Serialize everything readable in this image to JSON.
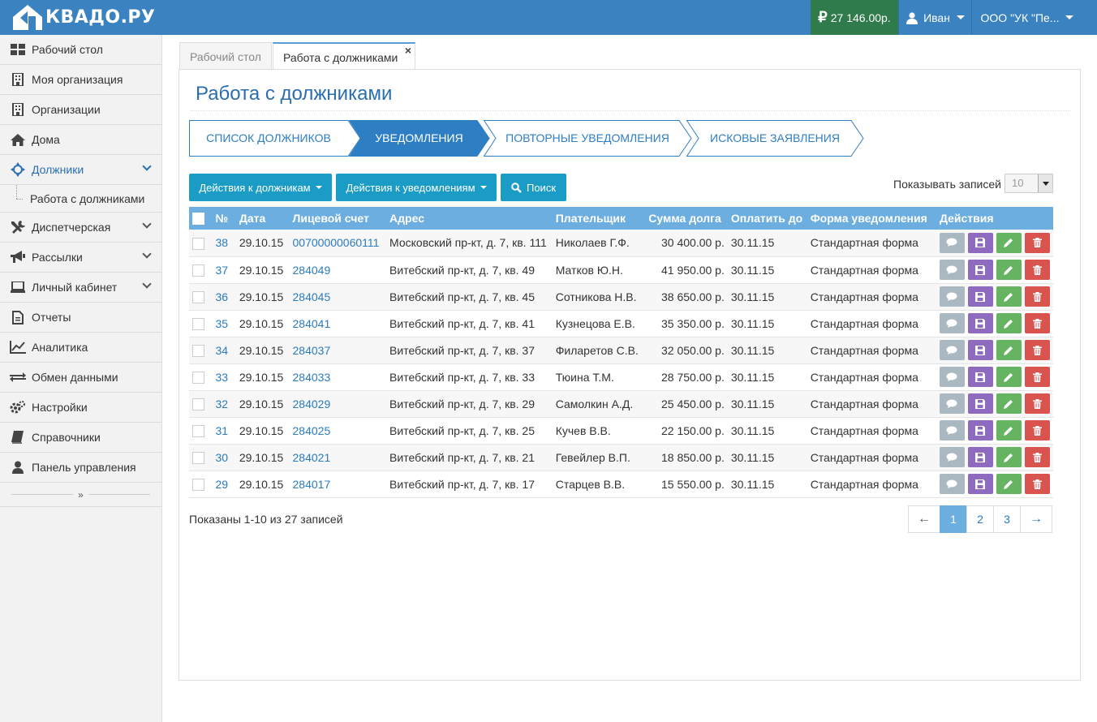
{
  "topbar": {
    "logo": "КВАДО.РУ",
    "balance": "27 146.00р.",
    "user": "Иван",
    "org": "ООО \"УК \"Пе..."
  },
  "sidebar": {
    "items": [
      {
        "label": "Рабочий стол",
        "icon": "dashboard-icon"
      },
      {
        "label": "Моя организация",
        "icon": "building-icon"
      },
      {
        "label": "Организации",
        "icon": "building-icon"
      },
      {
        "label": "Дома",
        "icon": "home-icon"
      },
      {
        "label": "Должники",
        "icon": "debtors-icon",
        "expanded": true
      },
      {
        "label": "Диспетчерская",
        "icon": "tools-icon"
      },
      {
        "label": "Рассылки",
        "icon": "megaphone-icon"
      },
      {
        "label": "Личный кабинет",
        "icon": "laptop-icon"
      },
      {
        "label": "Отчеты",
        "icon": "document-icon"
      },
      {
        "label": "Аналитика",
        "icon": "chart-line-icon"
      },
      {
        "label": "Обмен данными",
        "icon": "exchange-icon"
      },
      {
        "label": "Настройки",
        "icon": "gears-icon"
      },
      {
        "label": "Справочники",
        "icon": "book-icon"
      },
      {
        "label": "Панель управления",
        "icon": "user-icon"
      }
    ],
    "sub_item": "Работа с должниками",
    "collapse": "»"
  },
  "tabs": [
    {
      "label": "Рабочий стол"
    },
    {
      "label": "Работа с должниками",
      "close": "×"
    }
  ],
  "page": {
    "title": "Работа с должниками",
    "steps": [
      "СПИСОК ДОЛЖНИКОВ",
      "УВЕДОМЛЕНИЯ",
      "ПОВТОРНЫЕ УВЕДОМЛЕНИЯ",
      "ИСКОВЫЕ ЗАЯВЛЕНИЯ"
    ],
    "active_step": 1,
    "buttons": {
      "debtors": "Действия к должникам",
      "notices": "Действия к уведомлениям",
      "search": "Поиск"
    },
    "show_records_label": "Показывать записей",
    "show_records_value": "10"
  },
  "table": {
    "headers": [
      "№",
      "Дата",
      "Лицевой счет",
      "Адрес",
      "Плательщик",
      "Сумма долга",
      "Оплатить до",
      "Форма уведомления",
      "Действия"
    ],
    "rows": [
      {
        "n": "38",
        "date": "29.10.15",
        "account": "00700000060111",
        "address": "Московский пр-кт, д. 7, кв. 111",
        "payer": "Николаев Г.Ф.",
        "sum": "30 400.00 р.",
        "due": "30.11.15",
        "form": "Стандартная форма"
      },
      {
        "n": "37",
        "date": "29.10.15",
        "account": "284049",
        "address": "Витебский пр-кт, д. 7, кв. 49",
        "payer": "Матков Ю.Н.",
        "sum": "41 950.00 р.",
        "due": "30.11.15",
        "form": "Стандартная форма"
      },
      {
        "n": "36",
        "date": "29.10.15",
        "account": "284045",
        "address": "Витебский пр-кт, д. 7, кв. 45",
        "payer": "Сотникова Н.В.",
        "sum": "38 650.00 р.",
        "due": "30.11.15",
        "form": "Стандартная форма"
      },
      {
        "n": "35",
        "date": "29.10.15",
        "account": "284041",
        "address": "Витебский пр-кт, д. 7, кв. 41",
        "payer": "Кузнецова Е.В.",
        "sum": "35 350.00 р.",
        "due": "30.11.15",
        "form": "Стандартная форма"
      },
      {
        "n": "34",
        "date": "29.10.15",
        "account": "284037",
        "address": "Витебский пр-кт, д. 7, кв. 37",
        "payer": "Филаретов С.В.",
        "sum": "32 050.00 р.",
        "due": "30.11.15",
        "form": "Стандартная форма"
      },
      {
        "n": "33",
        "date": "29.10.15",
        "account": "284033",
        "address": "Витебский пр-кт, д. 7, кв. 33",
        "payer": "Тюина Т.М.",
        "sum": "28 750.00 р.",
        "due": "30.11.15",
        "form": "Стандартная форма"
      },
      {
        "n": "32",
        "date": "29.10.15",
        "account": "284029",
        "address": "Витебский пр-кт, д. 7, кв. 29",
        "payer": "Самолкин А.Д.",
        "sum": "25 450.00 р.",
        "due": "30.11.15",
        "form": "Стандартная форма"
      },
      {
        "n": "31",
        "date": "29.10.15",
        "account": "284025",
        "address": "Витебский пр-кт, д. 7, кв. 25",
        "payer": "Кучев В.В.",
        "sum": "22 150.00 р.",
        "due": "30.11.15",
        "form": "Стандартная форма"
      },
      {
        "n": "30",
        "date": "29.10.15",
        "account": "284021",
        "address": "Витебский пр-кт, д. 7, кв. 21",
        "payer": "Гевейлер В.П.",
        "sum": "18 850.00 р.",
        "due": "30.11.15",
        "form": "Стандартная форма"
      },
      {
        "n": "29",
        "date": "29.10.15",
        "account": "284017",
        "address": "Витебский пр-кт, д. 7, кв. 17",
        "payer": "Старцев В.В.",
        "sum": "15 550.00 р.",
        "due": "30.11.15",
        "form": "Стандартная форма"
      }
    ],
    "row_actions": [
      "comment-icon",
      "save-icon",
      "pencil-icon",
      "trash-icon"
    ]
  },
  "footer": {
    "shown": "Показаны 1-10 из 27 записей",
    "pages": [
      "1",
      "2",
      "3"
    ],
    "prev": "←",
    "next": "→",
    "current_page": "1"
  },
  "colors": {
    "topbar": "#3a83c0",
    "balance": "#2f7b4c",
    "accent": "#1a9cc6",
    "table_header": "#6caedf",
    "active_step": "#2e7ec4"
  }
}
